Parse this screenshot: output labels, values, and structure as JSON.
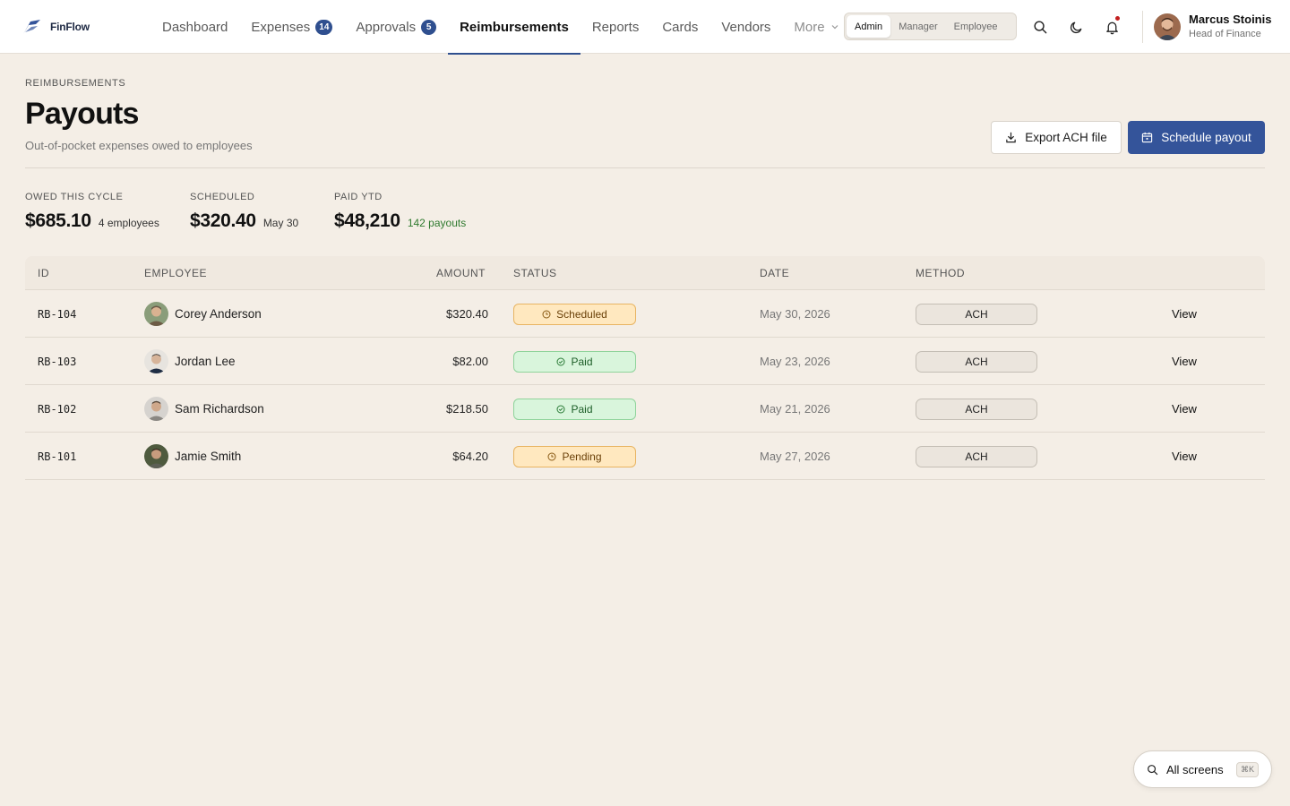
{
  "app": {
    "brand_name": "FinFlow",
    "accent_color": "#34549a"
  },
  "nav": {
    "items": [
      {
        "label": "Dashboard"
      },
      {
        "label": "Expenses",
        "badge": "14"
      },
      {
        "label": "Approvals",
        "badge": "5"
      },
      {
        "label": "Reimbursements",
        "active": true
      },
      {
        "label": "Reports"
      },
      {
        "label": "Cards"
      },
      {
        "label": "Vendors"
      },
      {
        "label": "More"
      }
    ]
  },
  "roles": {
    "options": [
      "Admin",
      "Manager",
      "Employee"
    ],
    "selected": "Admin"
  },
  "user": {
    "name": "Marcus Stoinis",
    "title": "Head of Finance"
  },
  "header": {
    "eyebrow": "REIMBURSEMENTS",
    "title": "Payouts",
    "subtitle": "Out-of-pocket expenses owed to employees",
    "export_label": "Export ACH file",
    "schedule_label": "Schedule payout"
  },
  "stats": [
    {
      "label": "OWED THIS CYCLE",
      "value": "$685.10",
      "note": "4 employees"
    },
    {
      "label": "SCHEDULED",
      "value": "$320.40",
      "note": "May 30"
    },
    {
      "label": "PAID YTD",
      "value": "$48,210",
      "note": "142 payouts"
    }
  ],
  "table": {
    "columns": [
      "ID",
      "EMPLOYEE",
      "AMOUNT",
      "STATUS",
      "DATE",
      "METHOD"
    ],
    "rows": [
      {
        "id": "RB-104",
        "employee": "Corey Anderson",
        "amount": "$320.40",
        "status": "Scheduled",
        "date": "May 30, 2026",
        "method": "ACH",
        "action": "View"
      },
      {
        "id": "RB-103",
        "employee": "Jordan Lee",
        "amount": "$82.00",
        "status": "Paid",
        "date": "May 23, 2026",
        "method": "ACH",
        "action": "View"
      },
      {
        "id": "RB-102",
        "employee": "Sam Richardson",
        "amount": "$218.50",
        "status": "Paid",
        "date": "May 21, 2026",
        "method": "ACH",
        "action": "View"
      },
      {
        "id": "RB-101",
        "employee": "Jamie Smith",
        "amount": "$64.20",
        "status": "Pending",
        "date": "May 27, 2026",
        "method": "ACH",
        "action": "View"
      }
    ]
  },
  "floating_search": {
    "label": "All screens",
    "shortcut": "⌘K"
  }
}
